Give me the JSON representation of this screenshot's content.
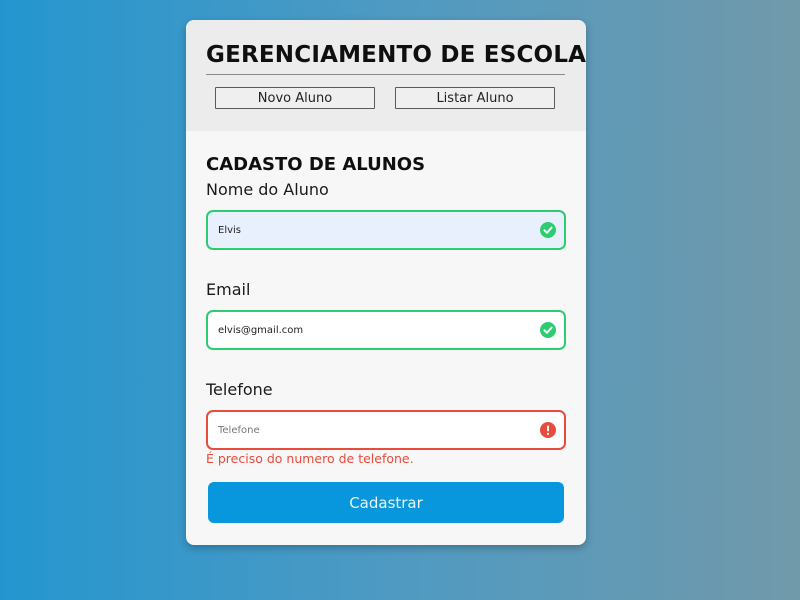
{
  "colors": {
    "background_left": "#2496cf",
    "background_right": "#7199aa",
    "valid_border": "#2ecc71",
    "error_border": "#e74c3c",
    "primary_button": "#0897dd"
  },
  "header": {
    "title": "GERENCIAMENTO DE ESCOLA",
    "nav": {
      "novo_aluno": "Novo Aluno",
      "listar_aluno": "Listar Aluno"
    }
  },
  "form": {
    "title": "CADASTO DE ALUNOS",
    "fields": {
      "nome": {
        "label": "Nome do Aluno",
        "value": "Elvis",
        "status": "valid",
        "icon": "check-circle-icon"
      },
      "email": {
        "label": "Email",
        "value": "elvis@gmail.com",
        "status": "valid",
        "icon": "check-circle-icon"
      },
      "telefone": {
        "label": "Telefone",
        "value": "",
        "placeholder": "Telefone",
        "status": "error",
        "icon": "exclamation-circle-icon",
        "error_message": "É preciso do numero de telefone."
      }
    },
    "submit_label": "Cadastrar"
  }
}
